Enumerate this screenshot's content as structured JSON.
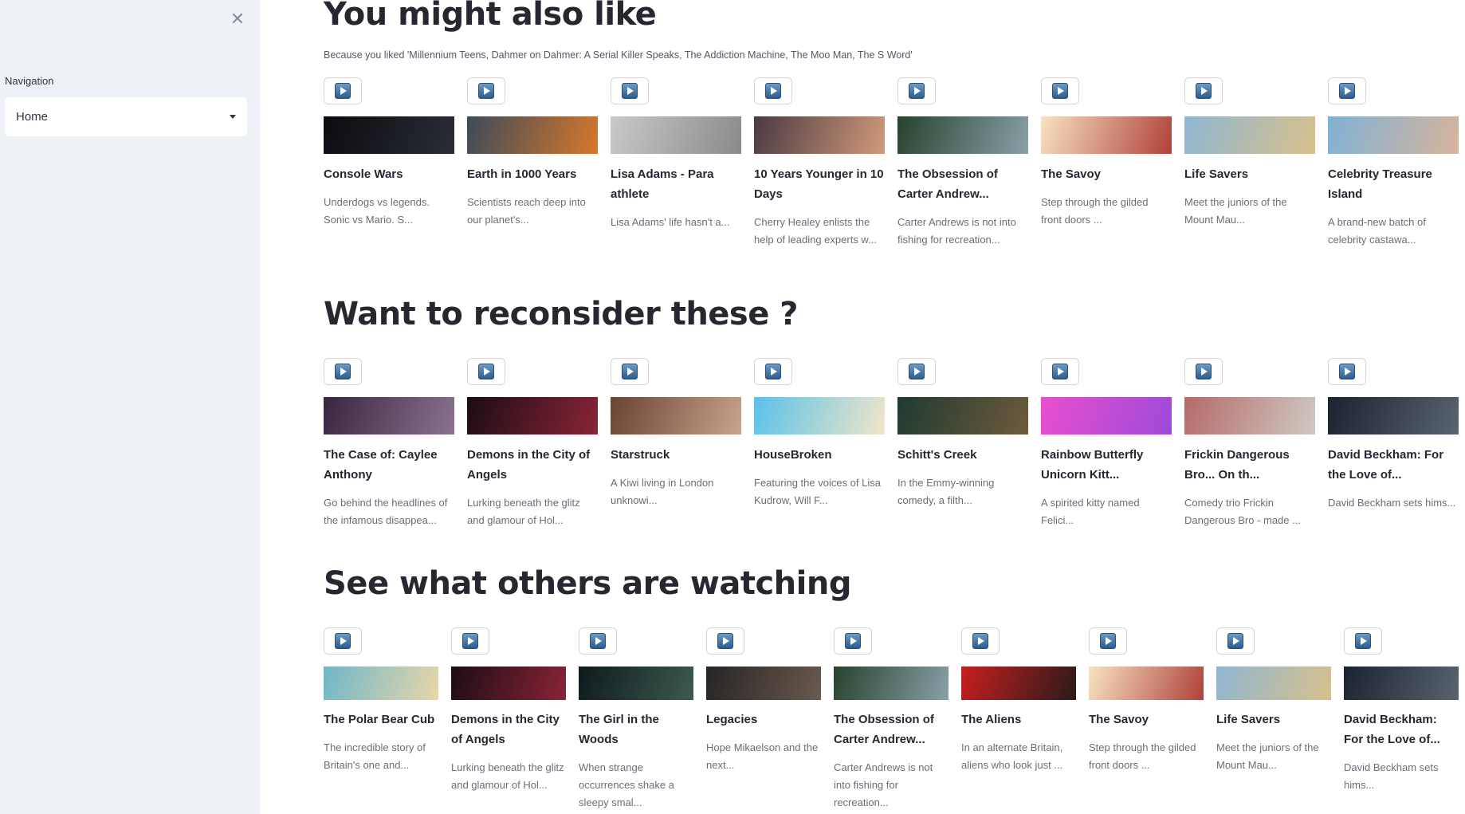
{
  "sidebar": {
    "close_icon": "close-icon",
    "nav_label": "Navigation",
    "nav_selected": "Home"
  },
  "sections": [
    {
      "title": "You might also like",
      "subtitle": "Because you liked 'Millennium Teens, Dahmer on Dahmer: A Serial Killer Speaks, The Addiction Machine, The Moo Man, The S Word'",
      "items": [
        {
          "title": "Console Wars",
          "desc": "Underdogs vs legends. Sonic vs Mario. S...",
          "colors": [
            "#0b0b10",
            "#2a2d36"
          ]
        },
        {
          "title": "Earth in 1000 Years",
          "desc": "Scientists reach deep into our planet's...",
          "colors": [
            "#3c4a5a",
            "#d8782a"
          ]
        },
        {
          "title": "Lisa Adams - Para athlete",
          "desc": "Lisa Adams' life hasn't a...",
          "colors": [
            "#c9c9c9",
            "#8a8a8a"
          ]
        },
        {
          "title": "10 Years Younger in 10 Days",
          "desc": "Cherry Healey enlists the help of leading experts w...",
          "colors": [
            "#4a3a42",
            "#d19a7a"
          ]
        },
        {
          "title": "The Obsession of Carter Andrew...",
          "desc": "Carter Andrews is not into fishing for recreation...",
          "colors": [
            "#27422e",
            "#8aa0a8"
          ]
        },
        {
          "title": "The Savoy",
          "desc": "Step through the gilded front doors ...",
          "colors": [
            "#f7e2c2",
            "#b0413a"
          ]
        },
        {
          "title": "Life Savers",
          "desc": "Meet the juniors of the Mount Mau...",
          "colors": [
            "#8fb6d3",
            "#d8c08a"
          ]
        },
        {
          "title": "Celebrity Treasure Island",
          "desc": "A brand-new batch of celebrity castawa...",
          "colors": [
            "#7fb1d6",
            "#d7b49a"
          ]
        }
      ]
    },
    {
      "title": "Want to reconsider these ?",
      "subtitle": "",
      "items": [
        {
          "title": "The Case of: Caylee Anthony",
          "desc": "Go behind the headlines of the infamous disappea...",
          "colors": [
            "#3a2540",
            "#8b7390"
          ]
        },
        {
          "title": "Demons in the City of Angels",
          "desc": "Lurking beneath the glitz and glamour of Hol...",
          "colors": [
            "#1c0c14",
            "#8a2436"
          ]
        },
        {
          "title": "Starstruck",
          "desc": "A Kiwi living in London unknowi...",
          "colors": [
            "#6a4434",
            "#c9a38a"
          ]
        },
        {
          "title": "HouseBroken",
          "desc": "Featuring the voices of Lisa Kudrow, Will F...",
          "colors": [
            "#59c1e8",
            "#f1e6c8"
          ]
        },
        {
          "title": "Schitt's Creek",
          "desc": "In the Emmy-winning comedy, a filth...",
          "colors": [
            "#1f3a30",
            "#6e5a3c"
          ]
        },
        {
          "title": "Rainbow Butterfly Unicorn Kitt...",
          "desc": "A spirited kitty named Felici...",
          "colors": [
            "#e94fcf",
            "#9c4ad8"
          ]
        },
        {
          "title": "Frickin Dangerous Bro... On th...",
          "desc": "Comedy trio Frickin Dangerous Bro - made ...",
          "colors": [
            "#b46a6a",
            "#cfc9c2"
          ]
        },
        {
          "title": "David Beckham: For the Love of...",
          "desc": "David Beckham sets hims...",
          "colors": [
            "#1b2230",
            "#5a6470"
          ]
        }
      ]
    },
    {
      "title": "See what others are watching",
      "subtitle": "",
      "items": [
        {
          "title": "The Polar Bear Cub",
          "desc": "The incredible story of Britain's one and...",
          "colors": [
            "#6fb6c9",
            "#e9d6a8"
          ]
        },
        {
          "title": "Demons in the City of Angels",
          "desc": "Lurking beneath the glitz and glamour of Hol...",
          "colors": [
            "#1c0c14",
            "#8a2436"
          ]
        },
        {
          "title": "The Girl in the Woods",
          "desc": "When strange occurrences shake a sleepy smal...",
          "colors": [
            "#0e1a1c",
            "#3c5a50"
          ]
        },
        {
          "title": "Legacies",
          "desc": "Hope Mikaelson and the next...",
          "colors": [
            "#262424",
            "#6b5a4e"
          ]
        },
        {
          "title": "The Obsession of Carter Andrew...",
          "desc": "Carter Andrews is not into fishing for recreation...",
          "colors": [
            "#27422e",
            "#8aa0a8"
          ]
        },
        {
          "title": "The Aliens",
          "desc": "In an alternate Britain, aliens who look just ...",
          "colors": [
            "#c61f1f",
            "#2a1a1a"
          ]
        },
        {
          "title": "The Savoy",
          "desc": "Step through the gilded front doors ...",
          "colors": [
            "#f7e2c2",
            "#b0413a"
          ]
        },
        {
          "title": "Life Savers",
          "desc": "Meet the juniors of the Mount Mau...",
          "colors": [
            "#8fb6d3",
            "#d8c08a"
          ]
        },
        {
          "title": "David Beckham: For the Love of...",
          "desc": "David Beckham sets hims...",
          "colors": [
            "#1b2230",
            "#5a6470"
          ]
        }
      ]
    }
  ]
}
